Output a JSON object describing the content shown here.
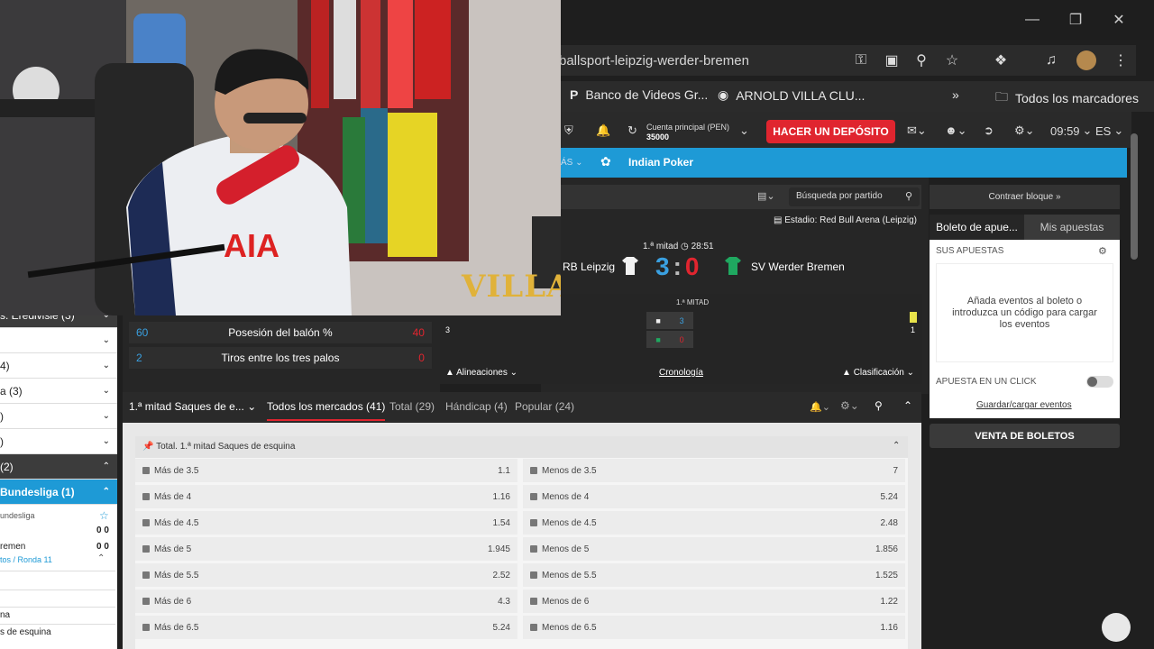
{
  "browser": {
    "url": "ballsport-leipzig-werder-bremen",
    "bookmarks": [
      "Banco de Videos Gr...",
      "ARNOLD VILLA CLU...",
      "Todos los marcadores"
    ],
    "more_bookmarks": "»"
  },
  "header": {
    "account_label": "Cuenta principal (PEN)",
    "account_balance": "35000",
    "deposit": "HACER UN DEPÓSITO",
    "time": "09:59",
    "lang": "ES"
  },
  "nav": {
    "item_partial": "ÁS",
    "indian_poker": "Indian Poker"
  },
  "event": {
    "search_placeholder": "Búsqueda por partido",
    "stadium": "Estadio: Red Bull Arena (Leipzig)",
    "period": "1.ª mitad",
    "clock": "28:51",
    "home_team": "RB Leipzig",
    "away_team": "SV Werder Bremen",
    "home_score": "3",
    "separator": ":",
    "away_score": "0",
    "half_label": "1.ª MITAD",
    "half_home": "3",
    "half_away": "0",
    "left_count": "3",
    "right_count": "1",
    "lineups": "Alineaciones",
    "timeline": "Cronología",
    "standings": "Clasificación"
  },
  "stats": [
    {
      "home": "60",
      "label": "Posesión del balón %",
      "away": "40"
    },
    {
      "home": "2",
      "label": "Tiros entre los tres palos",
      "away": "0"
    }
  ],
  "sidebar": {
    "rows": [
      {
        "label": "s. Eredivisie (3)",
        "style": "dark"
      },
      {
        "label": "",
        "style": "light"
      },
      {
        "label": "4)",
        "style": "light"
      },
      {
        "label": "a (3)",
        "style": "light"
      },
      {
        "label": ")",
        "style": "light"
      },
      {
        "label": ")",
        "style": "light"
      },
      {
        "label": "(2)",
        "style": "dark"
      },
      {
        "label": "Bundesliga (1)",
        "style": "blue"
      }
    ],
    "league": "undesliga",
    "score1": "0  0",
    "team2": "remen",
    "score2": "0  0",
    "round": "tos / Ronda 11",
    "item_a": "na",
    "item_b": "s de esquina"
  },
  "markets": {
    "selected": "1.ª mitad Saques de e...",
    "tabs": [
      "Todos los mercados (41)",
      "Total (29)",
      "Hándicap (4)",
      "Popular (24)"
    ],
    "group_title": "Total. 1.ª mitad Saques de esquina",
    "odds": [
      {
        "over": "Más de 3.5",
        "over_odd": "1.1",
        "under": "Menos de 3.5",
        "under_odd": "7"
      },
      {
        "over": "Más de 4",
        "over_odd": "1.16",
        "under": "Menos de 4",
        "under_odd": "5.24"
      },
      {
        "over": "Más de 4.5",
        "over_odd": "1.54",
        "under": "Menos de 4.5",
        "under_odd": "2.48"
      },
      {
        "over": "Más de 5",
        "over_odd": "1.945",
        "under": "Menos de 5",
        "under_odd": "1.856"
      },
      {
        "over": "Más de 5.5",
        "over_odd": "2.52",
        "under": "Menos de 5.5",
        "under_odd": "1.525"
      },
      {
        "over": "Más de 6",
        "over_odd": "4.3",
        "under": "Menos de 6",
        "under_odd": "1.22"
      },
      {
        "over": "Más de 6.5",
        "over_odd": "5.24",
        "under": "Menos de 6.5",
        "under_odd": "1.16"
      }
    ]
  },
  "betslip": {
    "collapse": "Contraer bloque »",
    "tab_slip": "Boleto de apue...",
    "tab_mine": "Mis apuestas",
    "your_bets": "SUS APUESTAS",
    "empty_msg": "Añada eventos al boleto o introduzca un código para cargar los eventos",
    "one_click": "APUESTA EN UN CLICK",
    "save_load": "Guardar/cargar eventos",
    "sell": "VENTA DE BOLETOS"
  },
  "overlay": {
    "brand": "VILLA",
    "jersey_text": "AIA"
  }
}
